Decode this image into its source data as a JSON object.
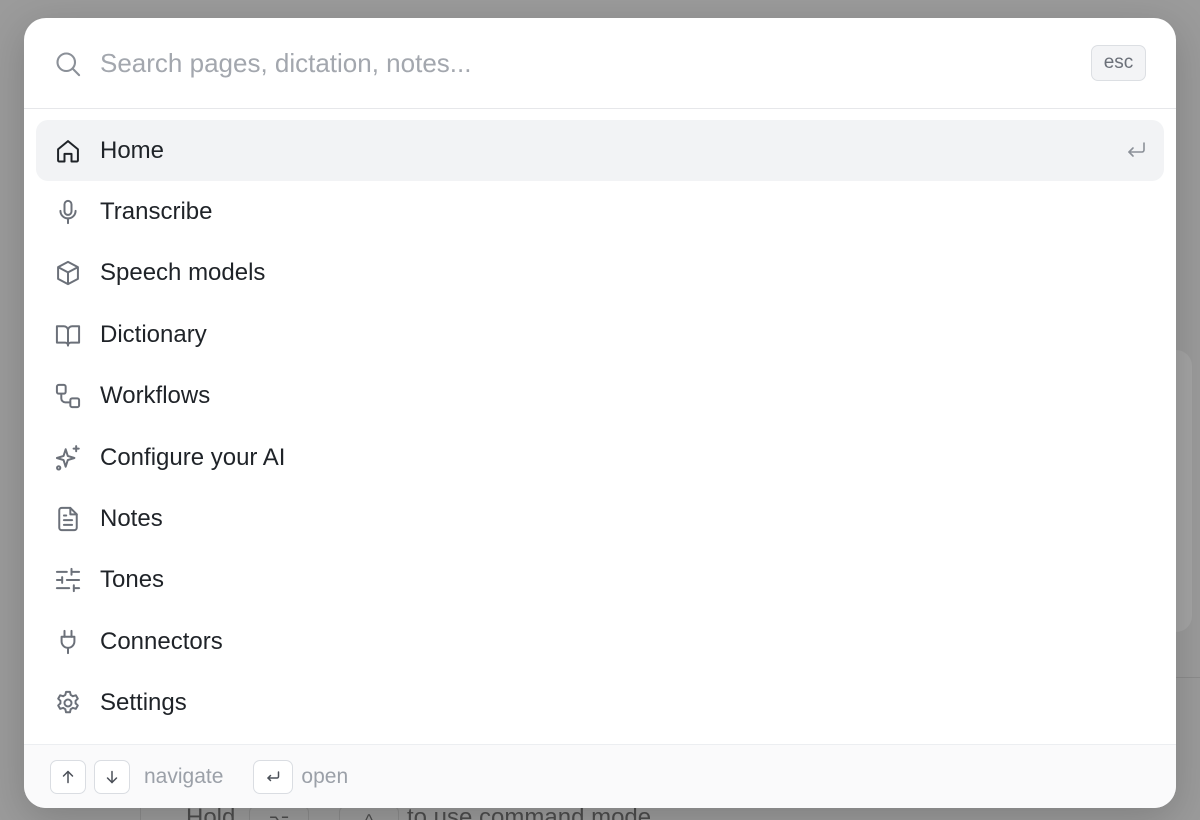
{
  "background": {
    "bottom_left_text": "Hold",
    "bottom_key": "⌥",
    "bottom_key_2": "^",
    "bottom_right_text": "to use command mode"
  },
  "search": {
    "placeholder": "Search pages, dictation, notes...",
    "value": "",
    "esc_label": "esc"
  },
  "items": [
    {
      "label": "Home",
      "icon": "home-icon",
      "active": true
    },
    {
      "label": "Transcribe",
      "icon": "microphone-icon"
    },
    {
      "label": "Speech models",
      "icon": "cube-icon"
    },
    {
      "label": "Dictionary",
      "icon": "book-open-icon"
    },
    {
      "label": "Workflows",
      "icon": "workflow-icon"
    },
    {
      "label": "Configure your AI",
      "icon": "sparkles-icon"
    },
    {
      "label": "Notes",
      "icon": "file-text-icon"
    },
    {
      "label": "Tones",
      "icon": "sliders-icon"
    },
    {
      "label": "Connectors",
      "icon": "plug-icon"
    },
    {
      "label": "Settings",
      "icon": "gear-icon"
    }
  ],
  "footer": {
    "navigate_label": "navigate",
    "open_label": "open"
  },
  "colors": {
    "overlay": "#9b9b9b",
    "active_row": "#f2f3f5",
    "text": "#1f2328",
    "icon": "#6b7079",
    "muted": "#9ba0a8"
  }
}
